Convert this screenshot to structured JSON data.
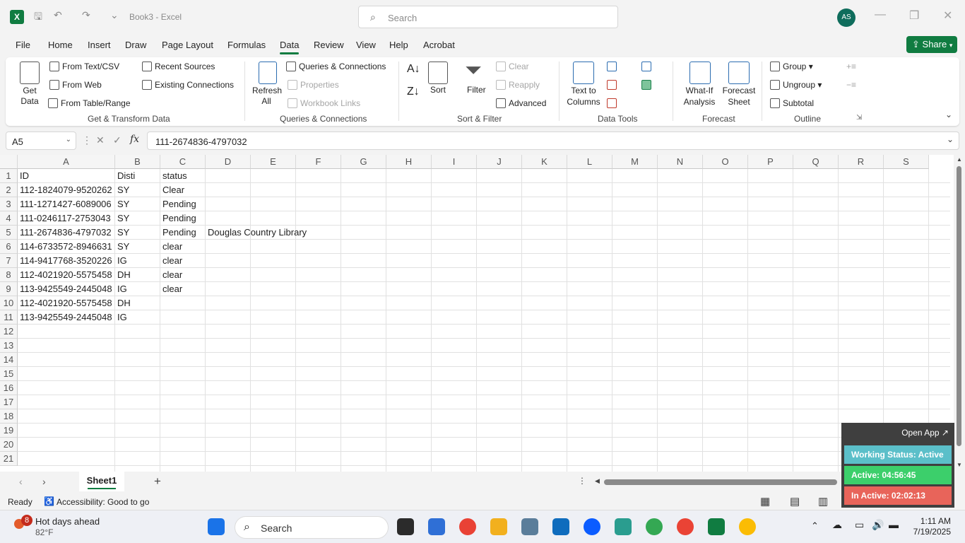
{
  "titlebar": {
    "doc_title": "Book3 - Excel",
    "search_placeholder": "Search",
    "avatar_initials": "AS"
  },
  "menu": {
    "tabs": [
      "File",
      "Home",
      "Insert",
      "Draw",
      "Page Layout",
      "Formulas",
      "Data",
      "Review",
      "View",
      "Help",
      "Acrobat"
    ],
    "active": "Data",
    "share_label": "Share"
  },
  "ribbon": {
    "get_data": "Get Data",
    "from_text_csv": "From Text/CSV",
    "from_web": "From Web",
    "from_table_range": "From Table/Range",
    "recent_sources": "Recent Sources",
    "existing_connections": "Existing Connections",
    "group_get_transform": "Get & Transform Data",
    "refresh_all": "Refresh All",
    "queries_connections": "Queries & Connections",
    "properties": "Properties",
    "workbook_links": "Workbook Links",
    "group_queries": "Queries & Connections",
    "sort": "Sort",
    "filter": "Filter",
    "clear": "Clear",
    "reapply": "Reapply",
    "advanced": "Advanced",
    "group_sort_filter": "Sort & Filter",
    "text_to_columns": "Text to Columns",
    "group_data_tools": "Data Tools",
    "what_if": "What-If Analysis",
    "forecast_sheet": "Forecast Sheet",
    "group_forecast": "Forecast",
    "group_btn": "Group",
    "ungroup": "Ungroup",
    "subtotal": "Subtotal",
    "group_outline": "Outline"
  },
  "formula_bar": {
    "name_box": "A5",
    "formula": "111-2674836-4797032"
  },
  "grid": {
    "columns": [
      "A",
      "B",
      "C",
      "D",
      "E",
      "F",
      "G",
      "H",
      "I",
      "J",
      "K",
      "L",
      "M",
      "N",
      "O",
      "P",
      "Q",
      "R",
      "S"
    ],
    "rows": [
      "1",
      "2",
      "3",
      "4",
      "5",
      "6",
      "7",
      "8",
      "9",
      "10",
      "11",
      "12",
      "13",
      "14",
      "15",
      "16",
      "17",
      "18",
      "19",
      "20",
      "21"
    ],
    "cells": [
      [
        "ID",
        "Disti",
        "status",
        ""
      ],
      [
        "112-1824079-9520262",
        "SY",
        "Clear",
        ""
      ],
      [
        "111-1271427-6089006",
        "SY",
        "Pending",
        ""
      ],
      [
        "111-0246117-2753043",
        "SY",
        "Pending",
        ""
      ],
      [
        "111-2674836-4797032",
        "SY",
        "Pending",
        "Douglas Country Library"
      ],
      [
        "114-6733572-8946631",
        "SY",
        "clear",
        ""
      ],
      [
        "114-9417768-3520226",
        "IG",
        "clear",
        ""
      ],
      [
        "112-4021920-5575458",
        "DH",
        "clear",
        ""
      ],
      [
        "113-9425549-2445048",
        "IG",
        "clear",
        ""
      ],
      [
        "112-4021920-5575458",
        "DH",
        "",
        ""
      ],
      [
        "113-9425549-2445048",
        "IG",
        "",
        ""
      ]
    ]
  },
  "sheets": {
    "active": "Sheet1"
  },
  "status": {
    "ready": "Ready",
    "accessibility": "Accessibility: Good to go"
  },
  "widget": {
    "open_app": "Open App ↗",
    "working_status": "Working Status: Active",
    "active": "Active: 04:56:45",
    "inactive": "In Active: 02:02:13",
    "colors": {
      "working": "#5bbfc9",
      "active": "#3ccf6b",
      "inactive": "#e8645a"
    }
  },
  "taskbar": {
    "weather_title": "Hot days ahead",
    "weather_temp": "82°F",
    "weather_badge": "8",
    "search": "Search",
    "time": "1:11 AM",
    "date": "7/19/2025"
  }
}
